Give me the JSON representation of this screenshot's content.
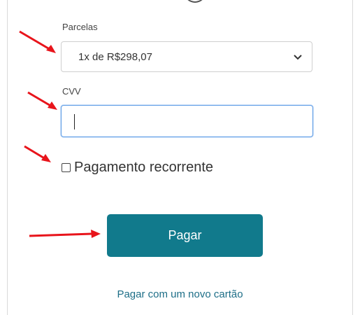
{
  "form": {
    "parcelas_label": "Parcelas",
    "parcelas_value": "1x de R$298,07",
    "cvv_label": "CVV",
    "cvv_value": "",
    "recurring_label": "Pagamento recorrente",
    "recurring_checked": false,
    "pay_button_label": "Pagar",
    "new_card_link": "Pagar com um novo cartão"
  },
  "colors": {
    "button_bg": "#117a8c",
    "link": "#1d6e87",
    "input_focus_border": "#5b9be6",
    "annotation_arrow": "#e8141b"
  },
  "icons": {
    "select_chevron": "chevron-down-icon",
    "annotation": "red-arrow-icon"
  }
}
